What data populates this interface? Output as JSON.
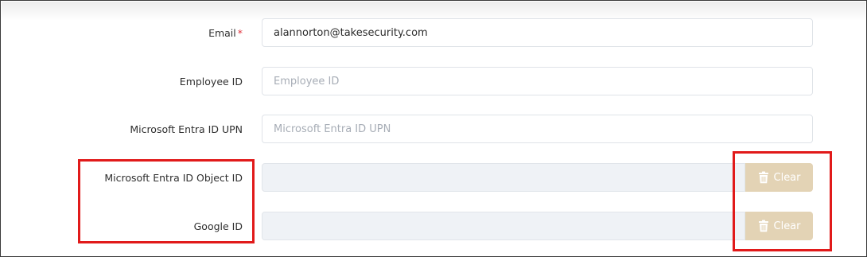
{
  "form": {
    "email": {
      "label": "Email",
      "required_mark": "*",
      "value": "alannorton@takesecurity.com"
    },
    "employee_id": {
      "label": "Employee ID",
      "placeholder": "Employee ID"
    },
    "entra_upn": {
      "label": "Microsoft Entra ID UPN",
      "placeholder": "Microsoft Entra ID UPN"
    },
    "entra_object_id": {
      "label": "Microsoft Entra ID Object ID",
      "value": "",
      "clear_label": "Clear",
      "icon": "trash-icon"
    },
    "google_id": {
      "label": "Google ID",
      "value": "",
      "clear_label": "Clear",
      "icon": "trash-icon"
    }
  },
  "colors": {
    "highlight": "#e11a1a",
    "clear_button": "#e3d3b5",
    "required": "#e0303a"
  }
}
